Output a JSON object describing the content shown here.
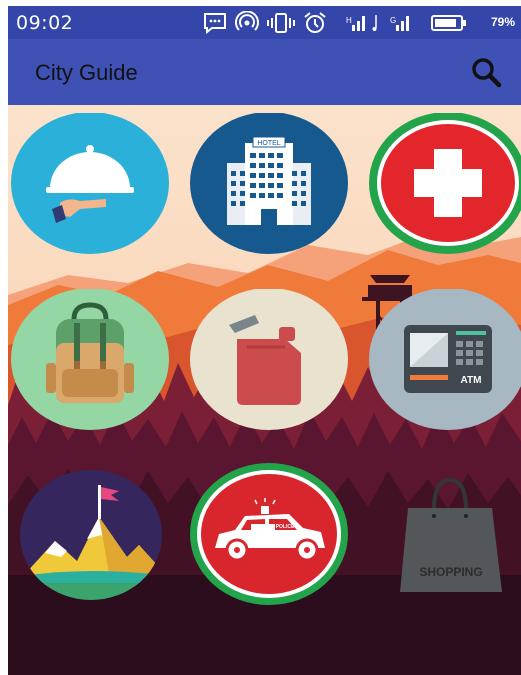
{
  "status_bar": {
    "time": "09:02",
    "battery_percent": "79%",
    "icons": [
      "message-icon",
      "hotspot-icon",
      "vibrate-icon",
      "alarm-icon",
      "signal-icon",
      "music-note-icon",
      "signal-icon",
      "battery-icon"
    ]
  },
  "app_bar": {
    "title": "City Guide",
    "search_icon": "search-icon"
  },
  "tiles": [
    {
      "name": "restaurant",
      "icon": "cloche-icon"
    },
    {
      "name": "hotel",
      "icon": "hotel-icon",
      "sign": "HOTEL"
    },
    {
      "name": "hospital",
      "icon": "medical-cross-icon"
    },
    {
      "name": "travel",
      "icon": "backpack-icon"
    },
    {
      "name": "fuel",
      "icon": "fuel-can-icon"
    },
    {
      "name": "atm",
      "icon": "atm-icon",
      "label": "ATM"
    },
    {
      "name": "tourism",
      "icon": "mountain-flag-icon"
    },
    {
      "name": "police",
      "icon": "police-car-icon",
      "label": "POLICE"
    },
    {
      "name": "shopping",
      "icon": "shopping-bag-icon",
      "label": "SHOPPING"
    }
  ],
  "colors": {
    "status_bar": "#3446a9",
    "app_bar": "#3f51b5",
    "sky": "#fbd6b8",
    "mountains": "#f07b3a",
    "forest": "#4a1228"
  }
}
